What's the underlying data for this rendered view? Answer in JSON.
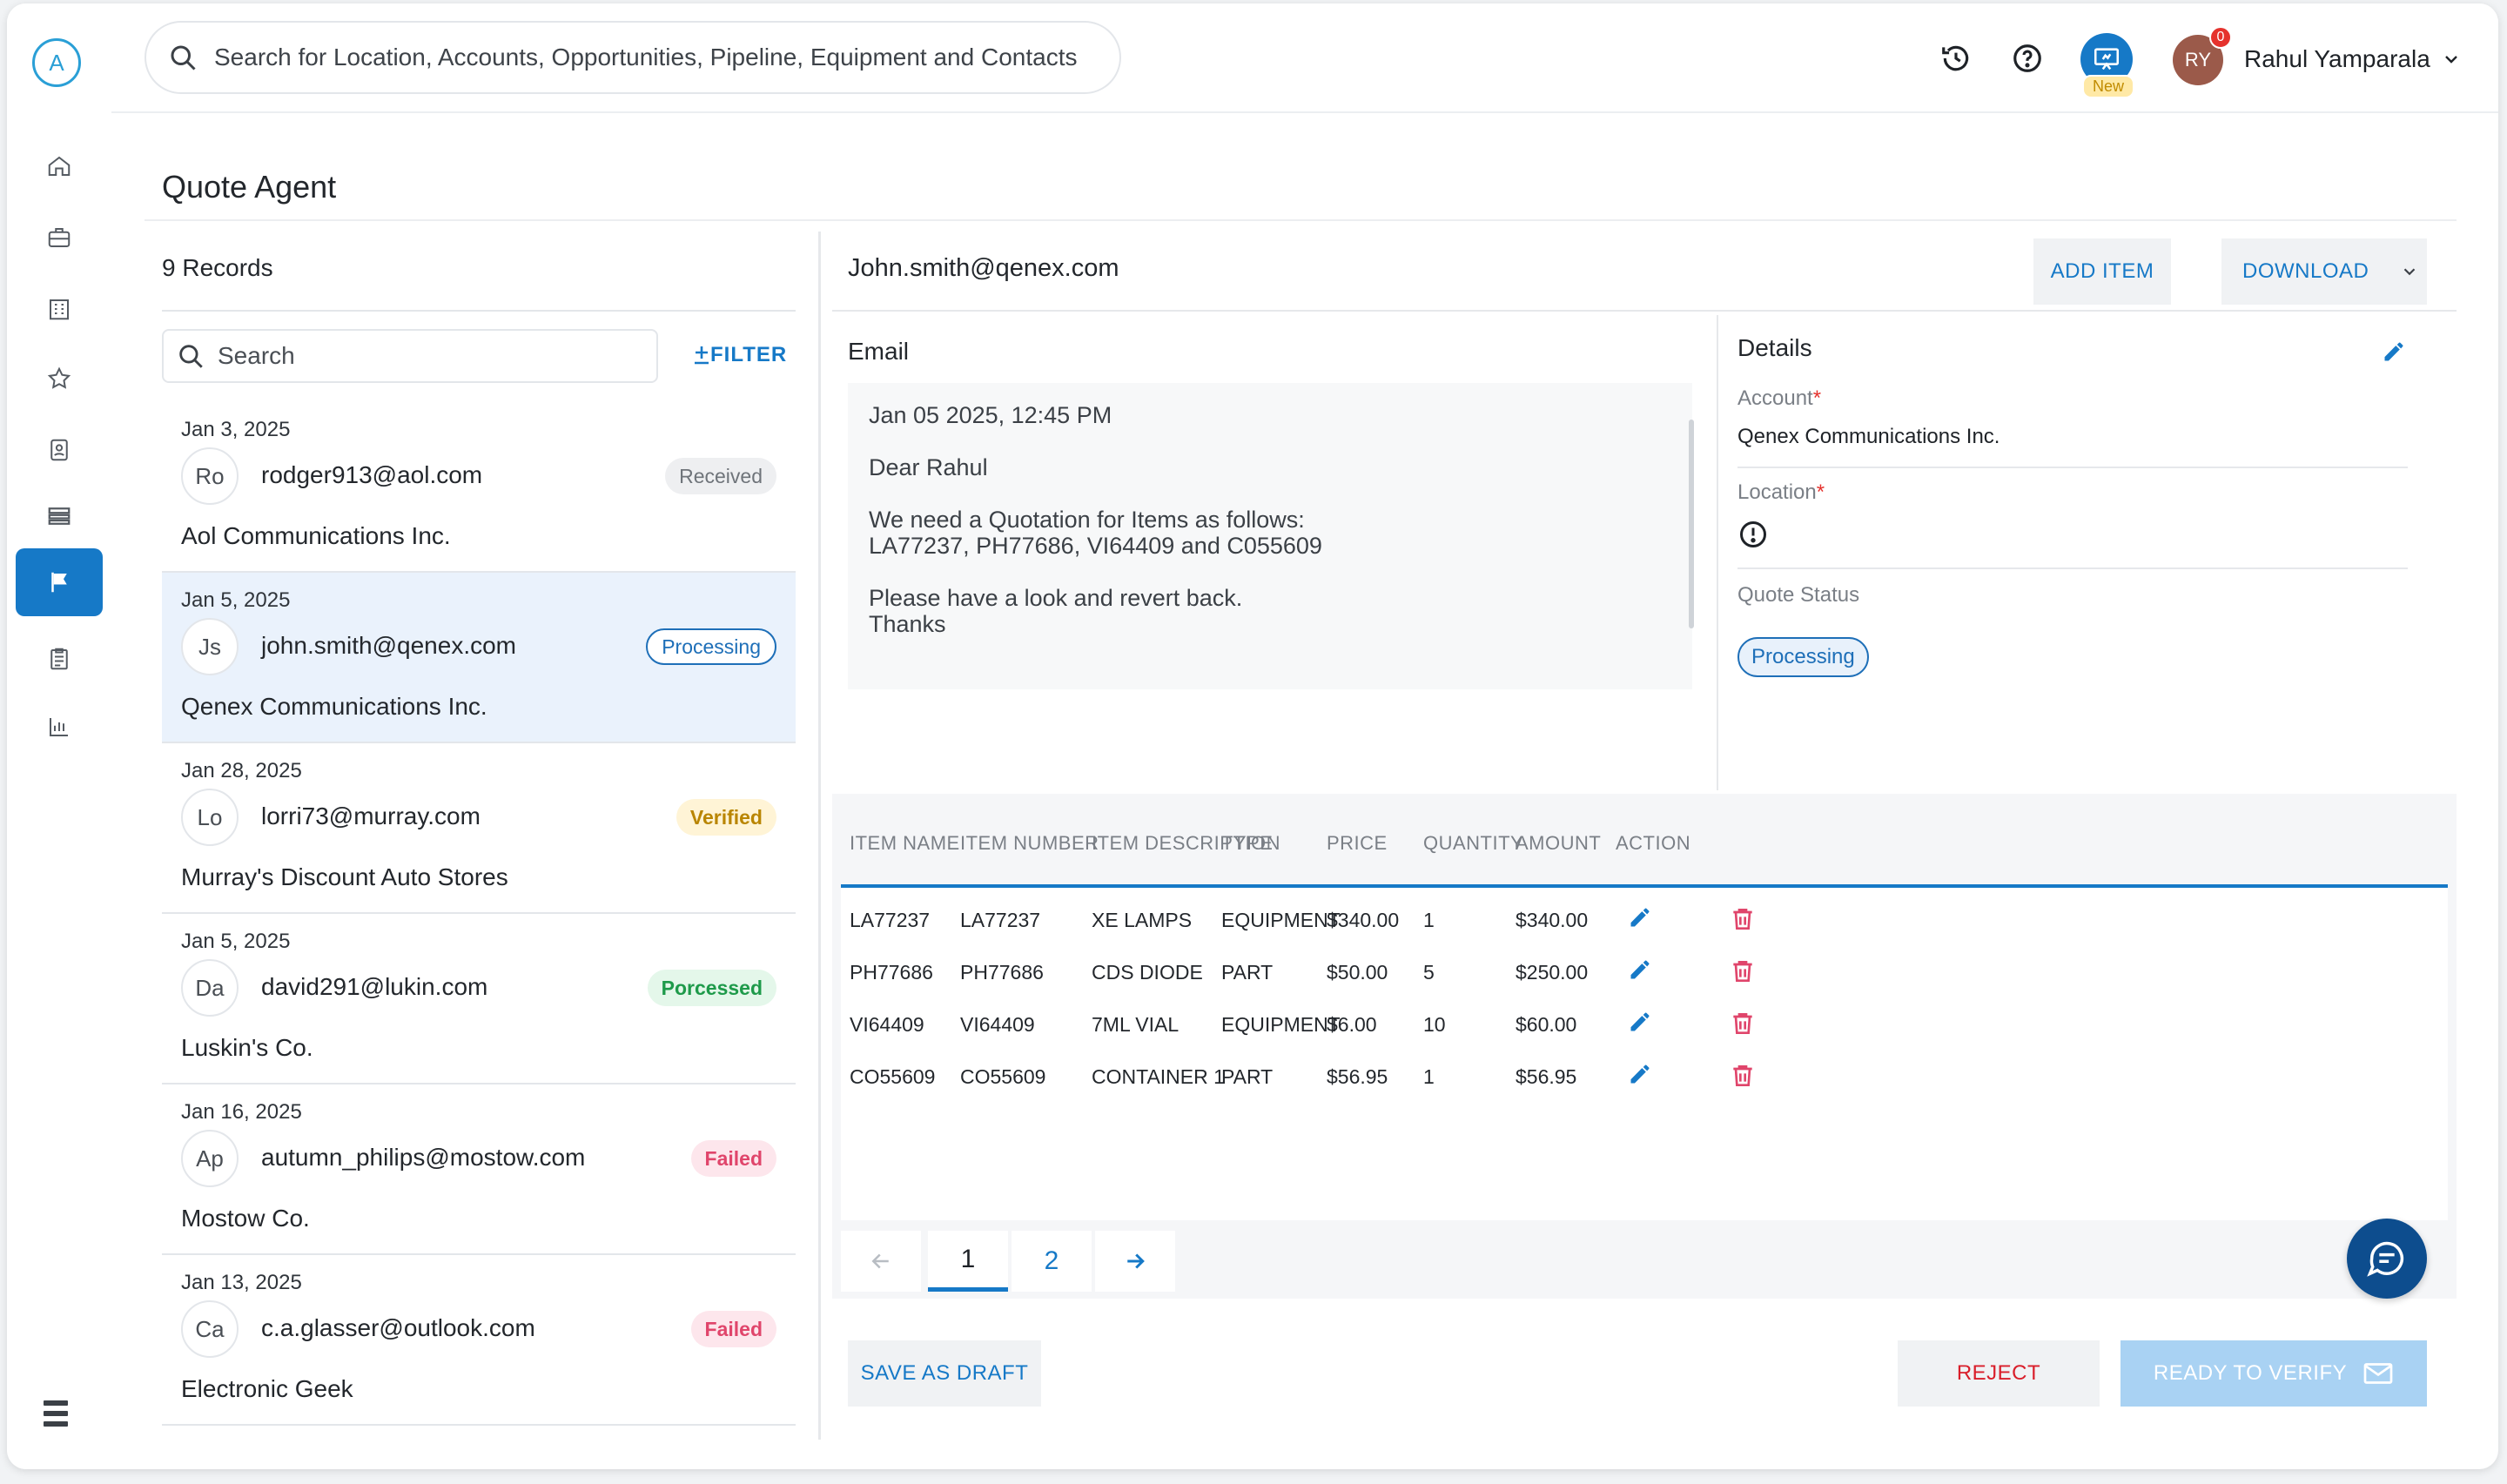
{
  "app": {
    "logo_letter": "A"
  },
  "topbar": {
    "search_placeholder": "Search for Location, Accounts, Opportunities, Pipeline, Equipment and Contacts",
    "new_tag": "New",
    "user_initials": "RY",
    "notification_count": "0",
    "user_name": "Rahul Yamparala"
  },
  "page": {
    "title": "Quote Agent"
  },
  "list": {
    "records_label": "9 Records",
    "search_placeholder": "Search",
    "filter_label": "FILTER",
    "records": [
      {
        "date": "Jan 3, 2025",
        "initials": "Ro",
        "email": "rodger913@aol.com",
        "company": "Aol Communications Inc.",
        "status": "Received",
        "status_class": "b-received"
      },
      {
        "date": "Jan 5, 2025",
        "initials": "Js",
        "email": "john.smith@qenex.com",
        "company": "Qenex Communications Inc.",
        "status": "Processing",
        "status_class": "b-processing"
      },
      {
        "date": "Jan 28, 2025",
        "initials": "Lo",
        "email": "lorri73@murray.com",
        "company": "Murray's Discount Auto Stores",
        "status": "Verified",
        "status_class": "b-verified"
      },
      {
        "date": "Jan 5, 2025",
        "initials": "Da",
        "email": "david291@lukin.com",
        "company": "Luskin's Co.",
        "status": "Porcessed",
        "status_class": "b-processed"
      },
      {
        "date": "Jan 16, 2025",
        "initials": "Ap",
        "email": "autumn_philips@mostow.com",
        "company": "Mostow Co.",
        "status": "Failed",
        "status_class": "b-failed"
      },
      {
        "date": "Jan 13, 2025",
        "initials": "Ca",
        "email": "c.a.glasser@outlook.com",
        "company": "Electronic Geek",
        "status": "Failed",
        "status_class": "b-failed"
      }
    ]
  },
  "detail": {
    "email_address": "John.smith@qenex.com",
    "add_item_label": "ADD ITEM",
    "download_label": "DOWNLOAD",
    "email_label": "Email",
    "email_body": {
      "timestamp": "Jan 05 2025, 12:45 PM",
      "greeting": "Dear Rahul",
      "line1": "We need a Quotation for Items as follows:",
      "line2": "LA77237, PH77686, VI64409 and C055609",
      "line3": "Please have a look and revert back.",
      "line4": "Thanks"
    },
    "details_title": "Details",
    "account_label": "Account",
    "account_value": "Qenex Communications Inc.",
    "location_label": "Location",
    "quote_status_label": "Quote Status",
    "quote_status_value": "Processing",
    "required_mark": "*"
  },
  "table": {
    "headers": [
      "ITEM NAME",
      "ITEM NUMBER",
      "ITEM DESCRIPTION",
      "TYPE",
      "PRICE",
      "QUANTITY",
      "AMOUNT",
      "ACTION"
    ],
    "rows": [
      {
        "name": "LA77237",
        "number": "LA77237",
        "description": "XE LAMPS",
        "type": "EQUIPMENT",
        "price": "$340.00",
        "quantity": "1",
        "amount": "$340.00"
      },
      {
        "name": "PH77686",
        "number": "PH77686",
        "description": "CDS DIODE",
        "type": "PART",
        "price": "$50.00",
        "quantity": "5",
        "amount": "$250.00"
      },
      {
        "name": "VI64409",
        "number": "VI64409",
        "description": "7ML VIAL",
        "type": "EQUIPMENT",
        "price": "$6.00",
        "quantity": "10",
        "amount": "$60.00"
      },
      {
        "name": "CO55609",
        "number": "CO55609",
        "description": "CONTAINER 1",
        "type": "PART",
        "price": "$56.95",
        "quantity": "1",
        "amount": "$56.95"
      }
    ],
    "pages": [
      "1",
      "2"
    ],
    "current_page": "1"
  },
  "actions": {
    "save_draft": "SAVE AS DRAFT",
    "reject": "REJECT",
    "ready": "READY TO VERIFY"
  },
  "colors": {
    "accent": "#1679c7",
    "danger": "#e0456b",
    "fab": "#0d4d8e"
  }
}
